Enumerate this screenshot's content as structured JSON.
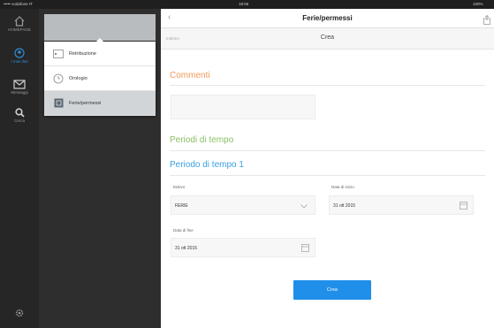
{
  "status": {
    "carrier": "••••• vodafone IT",
    "time": "18:56",
    "battery": "100%"
  },
  "colors": {
    "accent": "#1f8fea",
    "comments": "#f29a5a",
    "periods": "#8cc063",
    "period1": "#3aa0e2"
  },
  "sidebar": {
    "items": [
      {
        "label": "HOMEPAGE",
        "icon": "home-icon"
      },
      {
        "label": "I miei dati",
        "icon": "user-icon"
      },
      {
        "label": "Messaggi",
        "icon": "mail-icon"
      },
      {
        "label": "Cerca",
        "icon": "search-icon"
      }
    ],
    "settings_icon": "gear-icon"
  },
  "menu": {
    "items": [
      {
        "label": "Retribuzione",
        "icon": "document-icon"
      },
      {
        "label": "Orologio",
        "icon": "clock-icon"
      },
      {
        "label": "Ferie/permessi",
        "icon": "calendar-icon"
      }
    ]
  },
  "header": {
    "title": "Ferie/permessi",
    "back": "‹"
  },
  "subbar": {
    "back_link": "Indietro",
    "title": "Crea"
  },
  "form": {
    "comments_title": "Commenti",
    "comments_value": "",
    "periods_title": "Periodi di tempo",
    "period1_title": "Periodo di tempo 1",
    "reason_label": "Motivo",
    "reason_value": "FERIE",
    "start_label": "Data di inizio",
    "start_value": "31 ott 2015",
    "end_label": "Data di fine",
    "end_value": "31 ott 2015",
    "submit": "Crea"
  }
}
